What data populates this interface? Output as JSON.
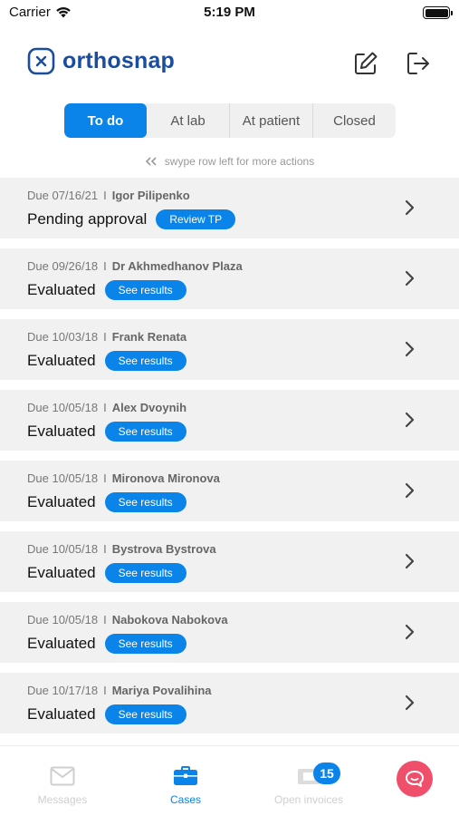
{
  "status_bar": {
    "carrier": "Carrier",
    "time": "5:19 PM"
  },
  "header": {
    "logo_text": "orthosnap",
    "edit_icon": "edit-icon",
    "logout_icon": "logout-icon"
  },
  "tabs": [
    {
      "label": "To do",
      "active": true
    },
    {
      "label": "At lab",
      "active": false
    },
    {
      "label": "At patient",
      "active": false
    },
    {
      "label": "Closed",
      "active": false
    }
  ],
  "hint": "swype row left for more actions",
  "rows": [
    {
      "due": "Due 07/16/21",
      "name": "Igor Pilipenko",
      "status": "Pending approval",
      "action": "Review TP"
    },
    {
      "due": "Due 09/26/18",
      "name": "Dr  Akhmedhanov Plaza",
      "status": "Evaluated",
      "action": "See results"
    },
    {
      "due": "Due 10/03/18",
      "name": "Frank Renata",
      "status": "Evaluated",
      "action": "See results"
    },
    {
      "due": "Due 10/05/18",
      "name": "Alex Dvoynih",
      "status": "Evaluated",
      "action": "See results"
    },
    {
      "due": "Due 10/05/18",
      "name": "Mironova Mironova",
      "status": "Evaluated",
      "action": "See results"
    },
    {
      "due": "Due 10/05/18",
      "name": "Bystrova Bystrova",
      "status": "Evaluated",
      "action": "See results"
    },
    {
      "due": "Due 10/05/18",
      "name": "Nabokova Nabokova",
      "status": "Evaluated",
      "action": "See results"
    },
    {
      "due": "Due 10/17/18",
      "name": "Mariya Povalihina",
      "status": "Evaluated",
      "action": "See results"
    }
  ],
  "row_separator": "I",
  "bottom_nav": {
    "messages": "Messages",
    "cases": "Cases",
    "open_invoices": "Open invoices",
    "invoice_badge": "15"
  },
  "colors": {
    "accent": "#0a84e8",
    "brand": "#1a4d9e",
    "chat": "#ef4f6b"
  }
}
